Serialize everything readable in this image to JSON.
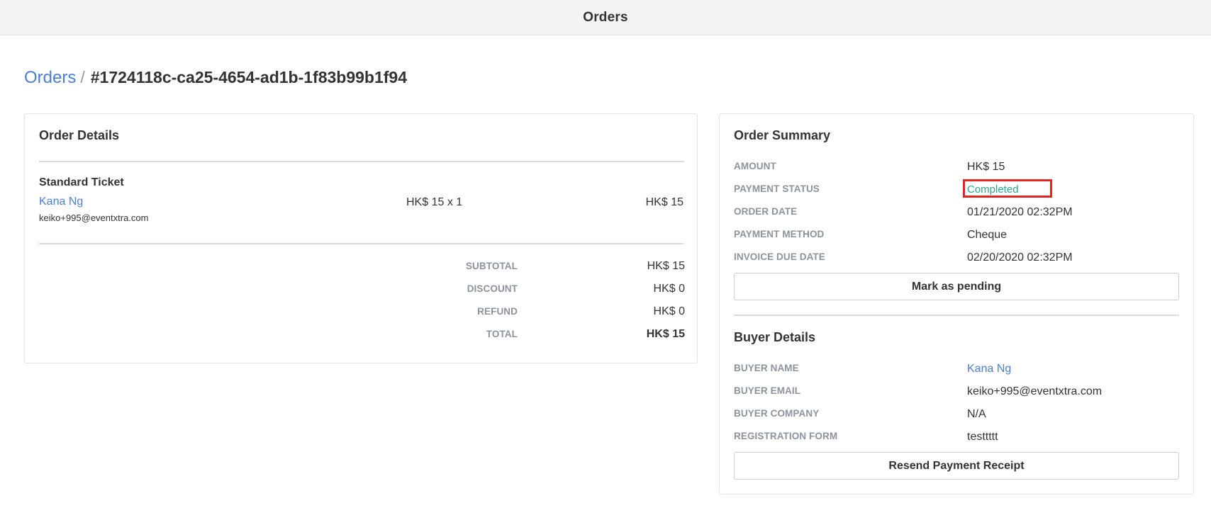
{
  "topbar": {
    "title": "Orders"
  },
  "breadcrumb": {
    "parent": "Orders",
    "separator": "/",
    "current": "#1724118c-ca25-4654-ad1b-1f83b99b1f94"
  },
  "order_details": {
    "title": "Order Details",
    "item": {
      "ticket_name": "Standard Ticket",
      "attendee_name": "Kana Ng",
      "attendee_email": "keiko+995@eventxtra.com",
      "price_qty": "HK$ 15 x 1",
      "line_total": "HK$ 15"
    },
    "totals": [
      {
        "label": "SUBTOTAL",
        "value": "HK$ 15"
      },
      {
        "label": "DISCOUNT",
        "value": "HK$ 0"
      },
      {
        "label": "REFUND",
        "value": "HK$ 0"
      },
      {
        "label": "TOTAL",
        "value": "HK$ 15"
      }
    ]
  },
  "order_summary": {
    "title": "Order Summary",
    "rows": [
      {
        "label": "AMOUNT",
        "value": "HK$ 15"
      },
      {
        "label": "PAYMENT STATUS",
        "value": "Completed"
      },
      {
        "label": "ORDER DATE",
        "value": "01/21/2020 02:32PM"
      },
      {
        "label": "PAYMENT METHOD",
        "value": "Cheque"
      },
      {
        "label": "INVOICE DUE DATE",
        "value": "02/20/2020 02:32PM"
      }
    ],
    "mark_pending_label": "Mark as pending",
    "status_color": "#2aa88c",
    "highlight_color": "#e6241f"
  },
  "buyer_details": {
    "title": "Buyer Details",
    "rows": [
      {
        "label": "BUYER NAME",
        "value": "Kana Ng"
      },
      {
        "label": "BUYER EMAIL",
        "value": "keiko+995@eventxtra.com"
      },
      {
        "label": "BUYER COMPANY",
        "value": "N/A"
      },
      {
        "label": "REGISTRATION FORM",
        "value": "testtttt"
      }
    ],
    "resend_label": "Resend Payment Receipt"
  },
  "colors": {
    "link": "#4a7fd8",
    "label_gray": "#8a939e",
    "topbar_bg": "#f3f3f3"
  }
}
